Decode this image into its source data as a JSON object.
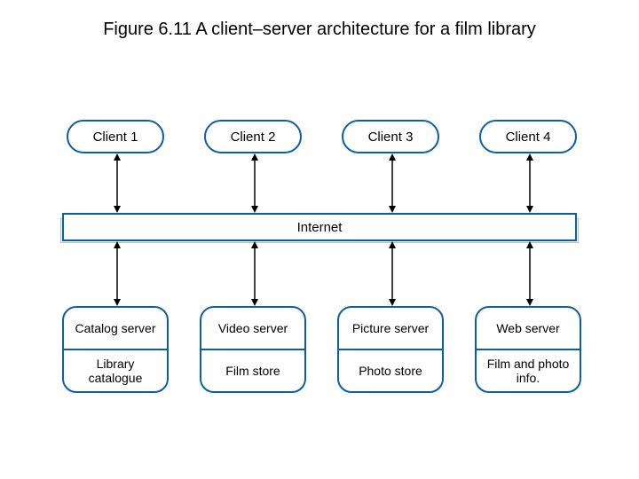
{
  "title": "Figure 6.11 A client–server architecture for a film library",
  "clients": [
    {
      "label": "Client 1"
    },
    {
      "label": "Client 2"
    },
    {
      "label": "Client 3"
    },
    {
      "label": "Client 4"
    }
  ],
  "middle": {
    "label": "Internet"
  },
  "servers": [
    {
      "top": "Catalog server",
      "bottom": "Library catalogue"
    },
    {
      "top": "Video server",
      "bottom": "Film store"
    },
    {
      "top": "Picture server",
      "bottom": "Photo store"
    },
    {
      "top": "Web server",
      "bottom": "Film and photo info."
    }
  ],
  "colors": {
    "border": "#0a5fa8"
  }
}
